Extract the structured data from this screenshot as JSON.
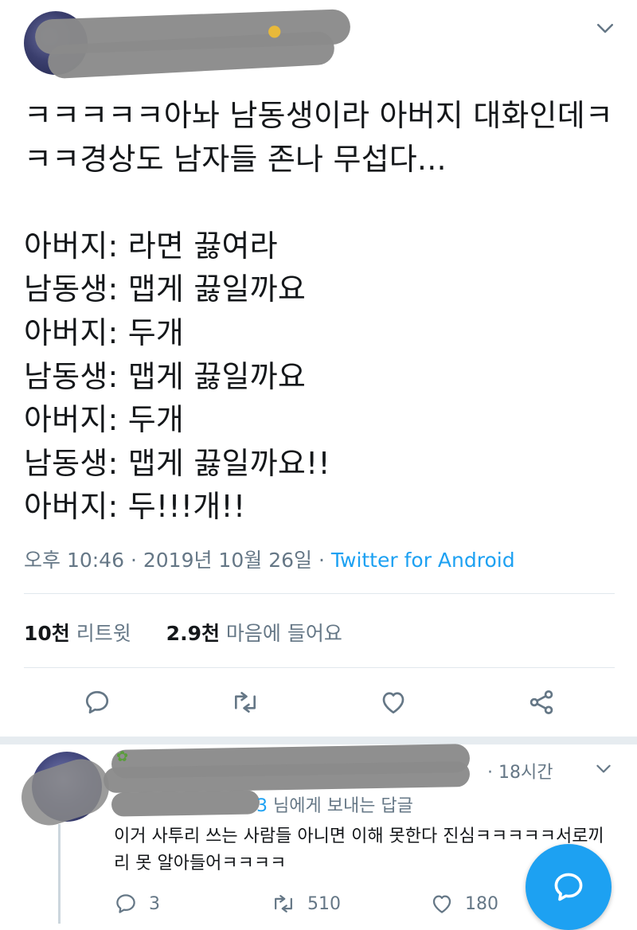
{
  "tweet": {
    "text": "ㅋㅋㅋㅋㅋ아놔 남동생이라 아버지 대화인데ㅋㅋㅋ경상도 남자들 존나 무섭다...\n\n아버지: 라면 끓여라\n남동생: 맵게 끓일까요\n아버지: 두개\n남동생: 맵게 끓일까요\n아버지: 두개\n남동생: 맵게 끓일까요!!\n아버지: 두!!!개!!",
    "time": "오후 10:46",
    "sep1": "·",
    "date": "2019년 10월 26일",
    "sep2": "·",
    "source": "Twitter for Android",
    "retweets_count": "10천",
    "retweets_label": "리트윗",
    "likes_count": "2.9천",
    "likes_label": "마음에 들어요"
  },
  "reply": {
    "time": "· 18시간",
    "reply_to_visible": "3",
    "reply_to_suffix": " 님에게 보내는 답글",
    "text": "이거 사투리 쓰는 사람들 아니면 이해 못한다 진심ㅋㅋㅋㅋㅋ서로끼리 못 알아들어ㅋㅋㅋㅋ",
    "reply_count": "3",
    "retweet_count": "510",
    "like_count": "180"
  },
  "icons": {
    "caret": "chevron-down-icon",
    "reply": "reply-icon",
    "retweet": "retweet-icon",
    "like": "heart-icon",
    "share": "share-icon",
    "compose": "compose-reply-icon"
  },
  "colors": {
    "accent": "#1da1f2",
    "secondary_text": "#657786",
    "divider": "#e1e8ed",
    "redaction": "#8a8a8a"
  }
}
